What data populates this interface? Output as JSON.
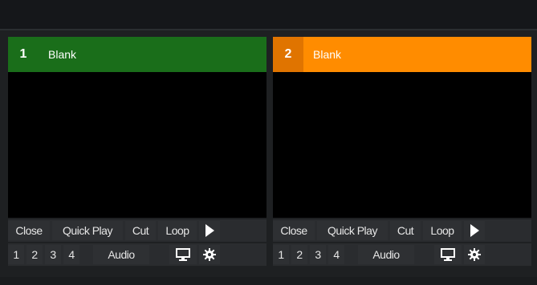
{
  "panels": [
    {
      "number": "1",
      "title": "Blank",
      "header_color": "#1a6e1a",
      "controls": {
        "close": "Close",
        "quick_play": "Quick Play",
        "cut": "Cut",
        "loop": "Loop",
        "play_icon": "play-icon"
      },
      "numbers": [
        "1",
        "2",
        "3",
        "4"
      ],
      "audio": "Audio",
      "icons": [
        "monitor-icon",
        "gear-icon"
      ]
    },
    {
      "number": "2",
      "title": "Blank",
      "header_color": "#ff8c00",
      "controls": {
        "close": "Close",
        "quick_play": "Quick Play",
        "cut": "Cut",
        "loop": "Loop",
        "play_icon": "play-icon"
      },
      "numbers": [
        "1",
        "2",
        "3",
        "4"
      ],
      "audio": "Audio",
      "icons": [
        "monitor-icon",
        "gear-icon"
      ]
    }
  ]
}
